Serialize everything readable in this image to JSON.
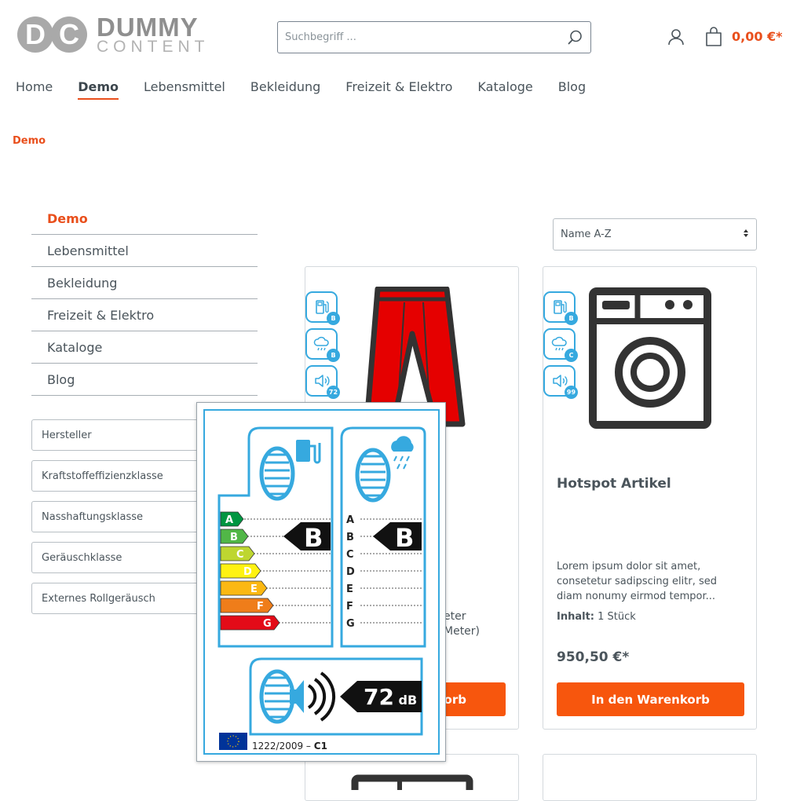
{
  "header": {
    "logo": {
      "line1": "DUMMY",
      "line2": "CONTENT"
    },
    "search_placeholder": "Suchbegriff ...",
    "cart_total": "0,00 €*"
  },
  "nav": [
    {
      "label": "Home"
    },
    {
      "label": "Demo",
      "active": true
    },
    {
      "label": "Lebensmittel"
    },
    {
      "label": "Bekleidung"
    },
    {
      "label": "Freizeit & Elektro"
    },
    {
      "label": "Kataloge"
    },
    {
      "label": "Blog"
    }
  ],
  "breadcrumb": "Demo",
  "sidebar": {
    "categories": [
      "Demo",
      "Lebensmittel",
      "Bekleidung",
      "Freizeit & Elektro",
      "Kataloge",
      "Blog"
    ],
    "filters": [
      "Hersteller",
      "Kraftstoffeffizienzklasse",
      "Nasshaftungsklasse",
      "Geräuschklasse",
      "Externes Rollgeräusch"
    ]
  },
  "sort": {
    "selected": "Name A-Z"
  },
  "products": [
    {
      "badges": [
        "B",
        "B",
        "72"
      ],
      "partial_desc_1": "eter",
      "partial_desc_2": "Meter)",
      "button": "orb"
    },
    {
      "badges": [
        "B",
        "C",
        "99"
      ],
      "title": "Hotspot Artikel",
      "description": "Lorem ipsum dolor sit amet, consetetur sadipscing elitr, sed diam nonumy eirmod tempor...",
      "content_label": "Inhalt:",
      "content_value": "1 Stück",
      "price": "950,50 €*",
      "button": "In den Warenkorb"
    }
  ],
  "eu_label": {
    "classes": [
      "A",
      "B",
      "C",
      "D",
      "E",
      "F",
      "G"
    ],
    "fuel_class": "B",
    "wet_class": "B",
    "noise_value": "72",
    "noise_unit": "dB",
    "regulation": "1222/2009 –",
    "regulation_suffix": "C1"
  },
  "colors": {
    "accent": "#e94f1c",
    "button": "#f7560d",
    "badge": "#36a9df",
    "text": "#4a545b"
  }
}
